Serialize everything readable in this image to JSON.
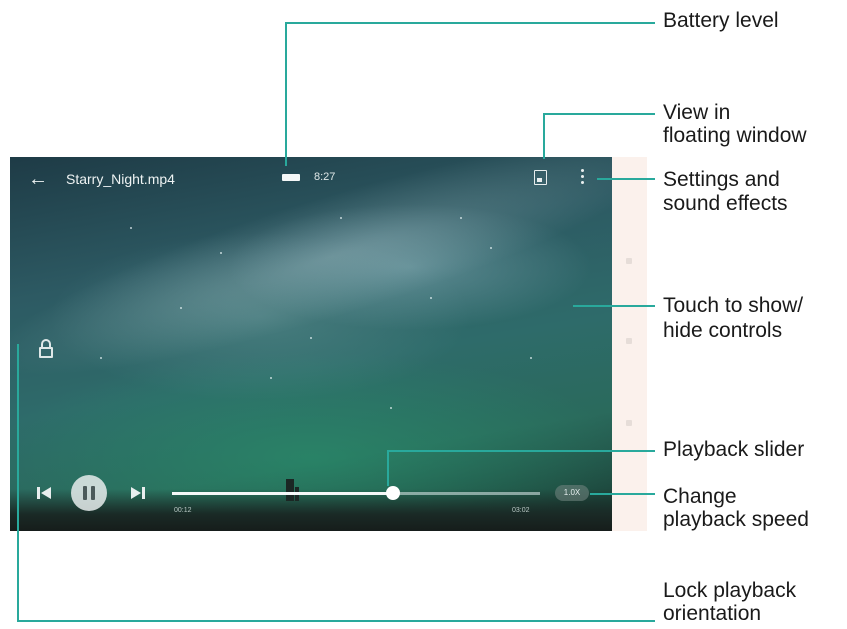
{
  "player": {
    "title": "Starry_Night.mp4",
    "time": "8:27",
    "playback": {
      "elapsed": "00:12",
      "total": "03:02",
      "progress": 0.6
    },
    "speed_label": "1.0X"
  },
  "callouts": {
    "battery": "Battery level",
    "floating": [
      "View in",
      "floating window"
    ],
    "settings": [
      "Settings and",
      "sound effects"
    ],
    "touch": [
      "Touch to show/",
      "hide controls"
    ],
    "slider": "Playback slider",
    "speed": [
      "Change",
      "playback speed"
    ],
    "lock": [
      "Lock playback",
      "orientation"
    ]
  },
  "icons": [
    "back-arrow-icon",
    "battery-icon",
    "floating-window-icon",
    "more-options-icon",
    "lock-icon",
    "previous-icon",
    "pause-icon",
    "next-icon"
  ],
  "colors": {
    "callout": "#29a99c"
  }
}
